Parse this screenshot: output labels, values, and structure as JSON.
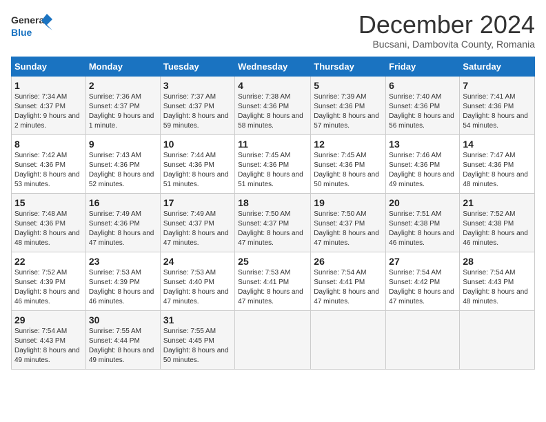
{
  "header": {
    "logo_line1": "General",
    "logo_line2": "Blue",
    "title": "December 2024",
    "subtitle": "Bucsani, Dambovita County, Romania"
  },
  "columns": [
    "Sunday",
    "Monday",
    "Tuesday",
    "Wednesday",
    "Thursday",
    "Friday",
    "Saturday"
  ],
  "weeks": [
    [
      {
        "day": "1",
        "sunrise": "Sunrise: 7:34 AM",
        "sunset": "Sunset: 4:37 PM",
        "daylight": "Daylight: 9 hours and 2 minutes."
      },
      {
        "day": "2",
        "sunrise": "Sunrise: 7:36 AM",
        "sunset": "Sunset: 4:37 PM",
        "daylight": "Daylight: 9 hours and 1 minute."
      },
      {
        "day": "3",
        "sunrise": "Sunrise: 7:37 AM",
        "sunset": "Sunset: 4:37 PM",
        "daylight": "Daylight: 8 hours and 59 minutes."
      },
      {
        "day": "4",
        "sunrise": "Sunrise: 7:38 AM",
        "sunset": "Sunset: 4:36 PM",
        "daylight": "Daylight: 8 hours and 58 minutes."
      },
      {
        "day": "5",
        "sunrise": "Sunrise: 7:39 AM",
        "sunset": "Sunset: 4:36 PM",
        "daylight": "Daylight: 8 hours and 57 minutes."
      },
      {
        "day": "6",
        "sunrise": "Sunrise: 7:40 AM",
        "sunset": "Sunset: 4:36 PM",
        "daylight": "Daylight: 8 hours and 56 minutes."
      },
      {
        "day": "7",
        "sunrise": "Sunrise: 7:41 AM",
        "sunset": "Sunset: 4:36 PM",
        "daylight": "Daylight: 8 hours and 54 minutes."
      }
    ],
    [
      {
        "day": "8",
        "sunrise": "Sunrise: 7:42 AM",
        "sunset": "Sunset: 4:36 PM",
        "daylight": "Daylight: 8 hours and 53 minutes."
      },
      {
        "day": "9",
        "sunrise": "Sunrise: 7:43 AM",
        "sunset": "Sunset: 4:36 PM",
        "daylight": "Daylight: 8 hours and 52 minutes."
      },
      {
        "day": "10",
        "sunrise": "Sunrise: 7:44 AM",
        "sunset": "Sunset: 4:36 PM",
        "daylight": "Daylight: 8 hours and 51 minutes."
      },
      {
        "day": "11",
        "sunrise": "Sunrise: 7:45 AM",
        "sunset": "Sunset: 4:36 PM",
        "daylight": "Daylight: 8 hours and 51 minutes."
      },
      {
        "day": "12",
        "sunrise": "Sunrise: 7:45 AM",
        "sunset": "Sunset: 4:36 PM",
        "daylight": "Daylight: 8 hours and 50 minutes."
      },
      {
        "day": "13",
        "sunrise": "Sunrise: 7:46 AM",
        "sunset": "Sunset: 4:36 PM",
        "daylight": "Daylight: 8 hours and 49 minutes."
      },
      {
        "day": "14",
        "sunrise": "Sunrise: 7:47 AM",
        "sunset": "Sunset: 4:36 PM",
        "daylight": "Daylight: 8 hours and 48 minutes."
      }
    ],
    [
      {
        "day": "15",
        "sunrise": "Sunrise: 7:48 AM",
        "sunset": "Sunset: 4:36 PM",
        "daylight": "Daylight: 8 hours and 48 minutes."
      },
      {
        "day": "16",
        "sunrise": "Sunrise: 7:49 AM",
        "sunset": "Sunset: 4:36 PM",
        "daylight": "Daylight: 8 hours and 47 minutes."
      },
      {
        "day": "17",
        "sunrise": "Sunrise: 7:49 AM",
        "sunset": "Sunset: 4:37 PM",
        "daylight": "Daylight: 8 hours and 47 minutes."
      },
      {
        "day": "18",
        "sunrise": "Sunrise: 7:50 AM",
        "sunset": "Sunset: 4:37 PM",
        "daylight": "Daylight: 8 hours and 47 minutes."
      },
      {
        "day": "19",
        "sunrise": "Sunrise: 7:50 AM",
        "sunset": "Sunset: 4:37 PM",
        "daylight": "Daylight: 8 hours and 47 minutes."
      },
      {
        "day": "20",
        "sunrise": "Sunrise: 7:51 AM",
        "sunset": "Sunset: 4:38 PM",
        "daylight": "Daylight: 8 hours and 46 minutes."
      },
      {
        "day": "21",
        "sunrise": "Sunrise: 7:52 AM",
        "sunset": "Sunset: 4:38 PM",
        "daylight": "Daylight: 8 hours and 46 minutes."
      }
    ],
    [
      {
        "day": "22",
        "sunrise": "Sunrise: 7:52 AM",
        "sunset": "Sunset: 4:39 PM",
        "daylight": "Daylight: 8 hours and 46 minutes."
      },
      {
        "day": "23",
        "sunrise": "Sunrise: 7:53 AM",
        "sunset": "Sunset: 4:39 PM",
        "daylight": "Daylight: 8 hours and 46 minutes."
      },
      {
        "day": "24",
        "sunrise": "Sunrise: 7:53 AM",
        "sunset": "Sunset: 4:40 PM",
        "daylight": "Daylight: 8 hours and 47 minutes."
      },
      {
        "day": "25",
        "sunrise": "Sunrise: 7:53 AM",
        "sunset": "Sunset: 4:41 PM",
        "daylight": "Daylight: 8 hours and 47 minutes."
      },
      {
        "day": "26",
        "sunrise": "Sunrise: 7:54 AM",
        "sunset": "Sunset: 4:41 PM",
        "daylight": "Daylight: 8 hours and 47 minutes."
      },
      {
        "day": "27",
        "sunrise": "Sunrise: 7:54 AM",
        "sunset": "Sunset: 4:42 PM",
        "daylight": "Daylight: 8 hours and 47 minutes."
      },
      {
        "day": "28",
        "sunrise": "Sunrise: 7:54 AM",
        "sunset": "Sunset: 4:43 PM",
        "daylight": "Daylight: 8 hours and 48 minutes."
      }
    ],
    [
      {
        "day": "29",
        "sunrise": "Sunrise: 7:54 AM",
        "sunset": "Sunset: 4:43 PM",
        "daylight": "Daylight: 8 hours and 49 minutes."
      },
      {
        "day": "30",
        "sunrise": "Sunrise: 7:55 AM",
        "sunset": "Sunset: 4:44 PM",
        "daylight": "Daylight: 8 hours and 49 minutes."
      },
      {
        "day": "31",
        "sunrise": "Sunrise: 7:55 AM",
        "sunset": "Sunset: 4:45 PM",
        "daylight": "Daylight: 8 hours and 50 minutes."
      },
      null,
      null,
      null,
      null
    ]
  ]
}
